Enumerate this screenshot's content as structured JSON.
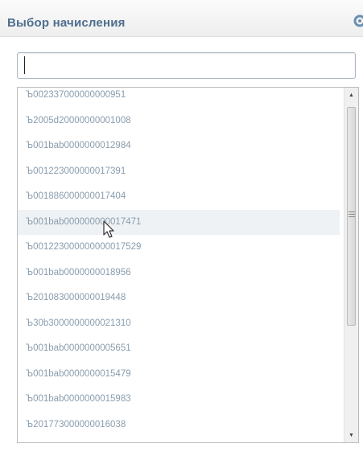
{
  "dialog": {
    "title": "Выбор начисления",
    "settings_icon": "gear-icon"
  },
  "search": {
    "value": "",
    "placeholder": ""
  },
  "list": {
    "items": [
      "Ъ002337000000000951",
      "Ъ2005d20000000001008",
      "Ъ001bab0000000012984",
      "Ъ001223000000017391",
      "Ъ001886000000017404",
      "Ъ001bab000000000017471",
      "Ъ001223000000000017529",
      "Ъ001bab0000000018956",
      "Ъ201083000000019448",
      "Ъ30b3000000000021310",
      "Ъ001bab0000000005651",
      "Ъ001bab0000000015479",
      "Ъ001bab0000000015983",
      "Ъ201773000000016038"
    ],
    "hover_index": 5,
    "text_color": "#8a9dad",
    "hover_color": "#eef2f5"
  },
  "scroll": {
    "up_icon": "arrow-up-icon",
    "down_icon": "arrow-down-icon",
    "thumb_position": 0.05
  },
  "colors": {
    "title": "#4e6e8e",
    "header_bg": "#eeeeee",
    "border": "#bcbcbc"
  }
}
